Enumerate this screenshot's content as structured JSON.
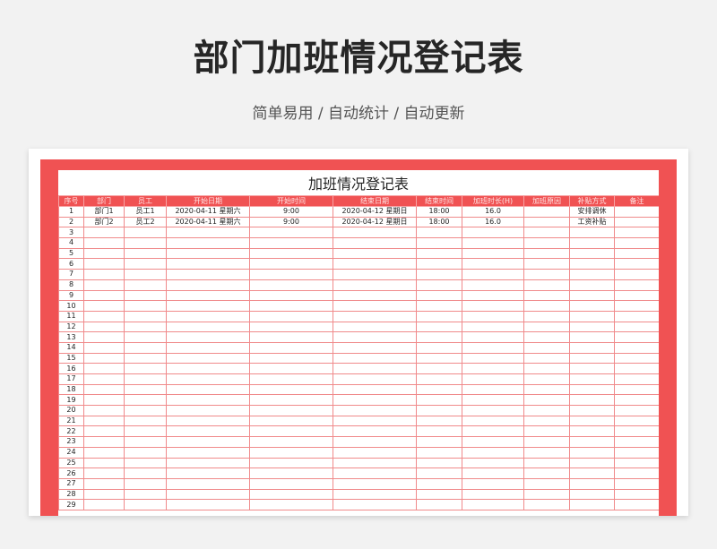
{
  "header": {
    "title": "部门加班情况登记表",
    "subtitle": "简单易用  /  自动统计  /  自动更新"
  },
  "sheet": {
    "title": "加班情况登记表",
    "columns": [
      "序号",
      "部门",
      "员工",
      "开始日期",
      "开始时间",
      "结束日期",
      "结束时间",
      "加班时长(H)",
      "加班原因",
      "补贴方式",
      "备注"
    ],
    "rows": [
      [
        "1",
        "部门1",
        "员工1",
        "2020-04-11  星期六",
        "9:00",
        "2020-04-12  星期日",
        "18:00",
        "16.0",
        "",
        "安排调休",
        ""
      ],
      [
        "2",
        "部门2",
        "员工2",
        "2020-04-11  星期六",
        "9:00",
        "2020-04-12  星期日",
        "18:00",
        "16.0",
        "",
        "工资补贴",
        ""
      ],
      [
        "3"
      ],
      [
        "4"
      ],
      [
        "5"
      ],
      [
        "6"
      ],
      [
        "7"
      ],
      [
        "8"
      ],
      [
        "9"
      ],
      [
        "10"
      ],
      [
        "11"
      ],
      [
        "12"
      ],
      [
        "13"
      ],
      [
        "14"
      ],
      [
        "15"
      ],
      [
        "16"
      ],
      [
        "17"
      ],
      [
        "18"
      ],
      [
        "19"
      ],
      [
        "20"
      ],
      [
        "21"
      ],
      [
        "22"
      ],
      [
        "23"
      ],
      [
        "24"
      ],
      [
        "25"
      ],
      [
        "26"
      ],
      [
        "27"
      ],
      [
        "28"
      ],
      [
        "29"
      ]
    ],
    "colors": {
      "accent": "#f05253",
      "grid": "#f08a8b"
    }
  }
}
